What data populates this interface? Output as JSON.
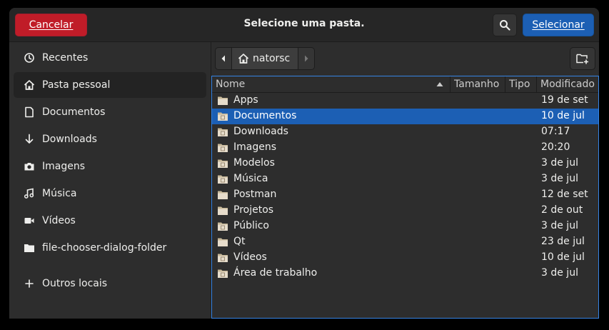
{
  "header": {
    "cancel_label": "Cancelar",
    "title": "Selecione uma pasta.",
    "select_label": "Selecionar"
  },
  "sidebar": {
    "items": [
      {
        "label": "Recentes",
        "icon": "clock-icon"
      },
      {
        "label": "Pasta pessoal",
        "icon": "home-icon",
        "active": true
      },
      {
        "label": "Documentos",
        "icon": "document-icon"
      },
      {
        "label": "Downloads",
        "icon": "download-icon"
      },
      {
        "label": "Imagens",
        "icon": "camera-icon"
      },
      {
        "label": "Música",
        "icon": "music-icon"
      },
      {
        "label": "Vídeos",
        "icon": "video-icon"
      },
      {
        "label": "file-chooser-dialog-folder",
        "icon": "folder-icon"
      },
      {
        "label": "Outros locais",
        "icon": "plus-icon"
      }
    ]
  },
  "pathbar": {
    "current": "natorsc"
  },
  "columns": {
    "name": "Nome",
    "size": "Tamanho",
    "type": "Tipo",
    "modified": "Modificado"
  },
  "files": [
    {
      "name": "Apps",
      "modified": "19 de set"
    },
    {
      "name": "Documentos",
      "modified": "10 de jul",
      "selected": true
    },
    {
      "name": "Downloads",
      "modified": "07:17"
    },
    {
      "name": "Imagens",
      "modified": "20:20"
    },
    {
      "name": "Modelos",
      "modified": "3 de jul"
    },
    {
      "name": "Música",
      "modified": "3 de jul"
    },
    {
      "name": "Postman",
      "modified": "12 de set"
    },
    {
      "name": "Projetos",
      "modified": "2 de out"
    },
    {
      "name": "Público",
      "modified": "3 de jul"
    },
    {
      "name": "Qt",
      "modified": "23 de jul"
    },
    {
      "name": "Vídeos",
      "modified": "10 de jul"
    },
    {
      "name": "Área de trabalho",
      "modified": "3 de jul"
    }
  ],
  "colors": {
    "destructive": "#c01c28",
    "accent": "#1c5fb4",
    "focus": "#3584e4"
  }
}
